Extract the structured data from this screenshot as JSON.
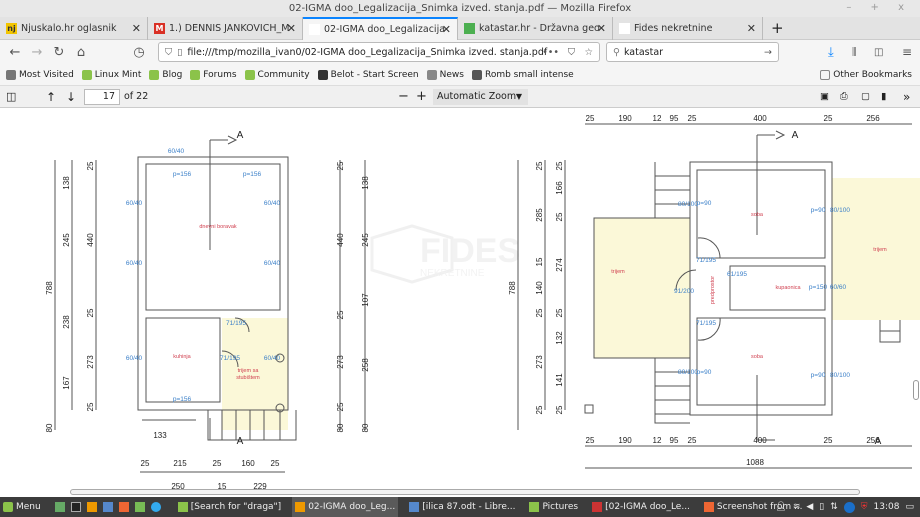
{
  "window": {
    "title": "02-IGMA doo_Legalizacija_Snimka izved. stanja.pdf — Mozilla Firefox",
    "controls": "– + x"
  },
  "tabs": [
    {
      "label": "Njuskalo.hr oglasnik",
      "icon": "nj",
      "color": "#f2c500"
    },
    {
      "label": "1.) DENNIS JANKOVICH_Medi",
      "icon": "M",
      "color": "#d93025"
    },
    {
      "label": "02-IGMA doo_Legalizacija_Snimk",
      "icon": "",
      "color": "#fff",
      "active": true
    },
    {
      "label": "katastar.hr - Državna geodet",
      "icon": "",
      "color": "#4caf50"
    },
    {
      "label": "Fides nekretnine",
      "icon": "",
      "color": "#fff"
    }
  ],
  "nav": {
    "url": "file:///tmp/mozilla_ivan0/02-IGMA doo_Legalizacija_Snimka izved. stanja.pdf",
    "search": "katastar",
    "more": "•••"
  },
  "bookmarks": [
    {
      "label": "Most Visited",
      "color": "#777"
    },
    {
      "label": "Linux Mint",
      "color": "#8bc34a"
    },
    {
      "label": "Blog",
      "color": "#8bc34a"
    },
    {
      "label": "Forums",
      "color": "#8bc34a"
    },
    {
      "label": "Community",
      "color": "#8bc34a"
    },
    {
      "label": "Belot - Start Screen",
      "color": "#333"
    },
    {
      "label": "News",
      "color": "#888"
    },
    {
      "label": "Romb small intense",
      "color": "#555"
    }
  ],
  "other_bookmarks": "Other Bookmarks",
  "pdf": {
    "page": "17",
    "of": "of 22",
    "zoom": "Automatic Zoom"
  },
  "drawing": {
    "watermark": "FIDES",
    "watermark_sub": "NEKRETNINE",
    "section": "A",
    "rooms": [
      "dnevni boravak",
      "kuhinja",
      "trijem sa",
      "stubištem",
      "soba",
      "trijem",
      "kupaonica",
      "soba",
      "trijem",
      "predprostor"
    ],
    "left_dims": [
      "788",
      "138",
      "245",
      "238",
      "167",
      "25",
      "440",
      "25",
      "273",
      "25",
      "80",
      "133",
      "25",
      "215",
      "25",
      "160",
      "25",
      "250",
      "15",
      "229"
    ],
    "mid_dims": [
      "25",
      "440",
      "25",
      "273",
      "25",
      "80",
      "138",
      "245",
      "107",
      "258",
      "80"
    ],
    "right_dims": [
      "788",
      "25",
      "285",
      "15",
      "140",
      "25",
      "273",
      "25",
      "25",
      "166",
      "25",
      "274",
      "25",
      "132",
      "141",
      "25"
    ],
    "right_h_dims": [
      "25",
      "190",
      "12",
      "95",
      "25",
      "400",
      "25",
      "256",
      "1088"
    ],
    "windows": [
      "60/40",
      "60/40",
      "60/40",
      "60/40",
      "60/40",
      "60/40",
      "60/40",
      "p=156",
      "p=156",
      "p=156",
      "71/195",
      "71/195",
      "80/100",
      "80/100",
      "80/100",
      "80/100",
      "60/60",
      "91/200",
      "61/195",
      "71/195",
      "71/195",
      "p=90",
      "p=90",
      "p=90",
      "p=90",
      "p=150"
    ]
  },
  "taskbar": {
    "menu": "Menu",
    "items": [
      "[Search for \"draga\"]",
      "02-IGMA doo_Leg...",
      "[ilica 87.odt - Libre...",
      "Pictures",
      "[02-IGMA doo_Le...",
      "Screenshot from ..."
    ],
    "time": "13:08"
  }
}
